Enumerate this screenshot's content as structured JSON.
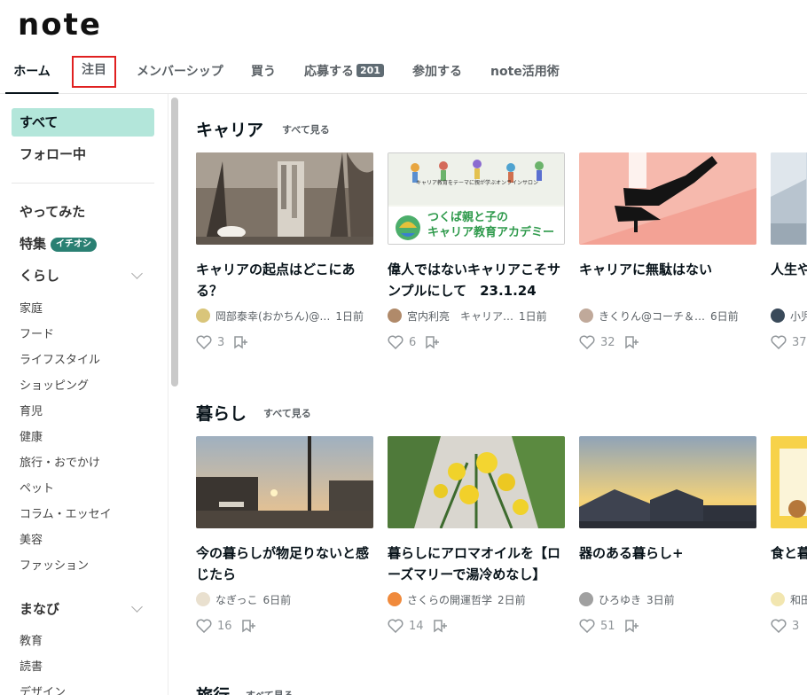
{
  "logo": "note",
  "tabs": [
    {
      "label": "ホーム",
      "active": true
    },
    {
      "label": "注目",
      "highlighted": true
    },
    {
      "label": "メンバーシップ"
    },
    {
      "label": "買う"
    },
    {
      "label": "応募する",
      "badge": "201"
    },
    {
      "label": "参加する"
    },
    {
      "label": "note活用術"
    }
  ],
  "sidebar": {
    "top_items": [
      "すべて",
      "フォロー中"
    ],
    "yattemita": "やってみた",
    "tokushu": "特集",
    "tokushu_badge": "イチオシ",
    "kurashi": {
      "label": "くらし",
      "items": [
        "家庭",
        "フード",
        "ライフスタイル",
        "ショッピング",
        "育児",
        "健康",
        "旅行・おでかけ",
        "ペット",
        "コラム・エッセイ",
        "美容",
        "ファッション"
      ]
    },
    "manabi": {
      "label": "まなび",
      "items": [
        "教育",
        "読書",
        "デザイン"
      ]
    }
  },
  "sections": [
    {
      "title": "キャリア",
      "more": "すべて見る",
      "cards": [
        {
          "title": "キャリアの起点はどこにある？",
          "author": "岡部泰幸(おかちん)@…",
          "date": "1日前",
          "likes": "3"
        },
        {
          "title": "偉人ではないキャリアこそサンプルにして　23.1.24",
          "author": "宮内利亮　キャリア…",
          "date": "1日前",
          "likes": "6",
          "thumb_text_top": "キャリア教育をテーマに親が学ぶオンラインサロン",
          "thumb_text_main1": "つくば親と子の",
          "thumb_text_main2": "キャリア教育アカデミー"
        },
        {
          "title": "キャリアに無駄はない",
          "author": "きくりん@コーチ＆…",
          "date": "6日前",
          "likes": "32"
        },
        {
          "title": "人生や後半戦",
          "author": "小児",
          "date": "",
          "likes": "37"
        }
      ]
    },
    {
      "title": "暮らし",
      "more": "すべて見る",
      "cards": [
        {
          "title": "今の暮らしが物足りないと感じたら",
          "author": "なぎっこ",
          "date": "6日前",
          "likes": "16"
        },
        {
          "title": "暮らしにアロマオイルを【ローズマリーで湯冷めなし】",
          "author": "さくらの開運哲学",
          "date": "2日前",
          "likes": "14"
        },
        {
          "title": "器のある暮らし+",
          "author": "ひろゆき",
          "date": "3日前",
          "likes": "51"
        },
        {
          "title": "食と暮シリテ",
          "author": "和田",
          "date": "",
          "likes": "3"
        }
      ]
    },
    {
      "title": "旅行",
      "more": "すべて見る"
    }
  ],
  "colors": {
    "accent": "#b3e6da",
    "badge": "#2a8073",
    "highlight_box": "#e02020"
  }
}
